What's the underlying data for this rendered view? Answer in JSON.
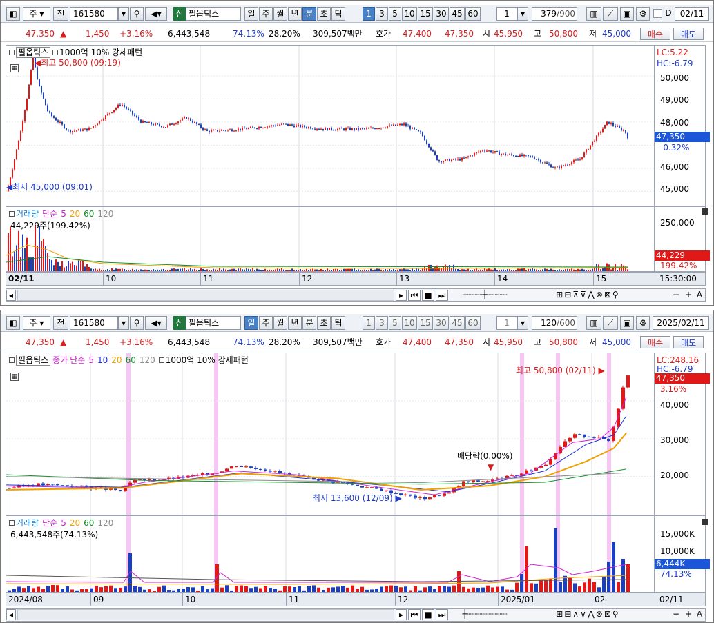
{
  "top": {
    "toolbar": {
      "type_label": "주",
      "prev_label": "전",
      "code": "161580",
      "market_badge": "신",
      "name": "필옵틱스",
      "periods": [
        "일",
        "주",
        "월",
        "년",
        "분",
        "초",
        "틱"
      ],
      "active_period": "분",
      "intervals": [
        "1",
        "3",
        "5",
        "10",
        "15",
        "30",
        "45",
        "60"
      ],
      "active_interval": "1",
      "unit_value": "1",
      "count": "379",
      "count_max": "/900",
      "d_label": "D",
      "date": "02/11"
    },
    "quote": {
      "price": "47,350",
      "arrow": "▲",
      "change": "1,450",
      "change_pct": "+3.16%",
      "volume": "6,443,548",
      "vol_ratio": "74.13%",
      "turnover": "28.20%",
      "amount": "309,507백만",
      "hoga_label": "호가",
      "ask": "47,400",
      "bid": "47,350",
      "open_label": "시",
      "open": "45,950",
      "high_label": "고",
      "high": "50,800",
      "low_label": "저",
      "low": "45,000",
      "buy_label": "매수",
      "sell_label": "매도"
    },
    "legend": {
      "name": "필옵틱스",
      "pattern": "1000억 10% 강세패턴"
    },
    "price_axis": {
      "lc": "LC:5.22",
      "hc": "HC:-6.79",
      "ticks": [
        "50,000",
        "49,000",
        "48,000",
        "46,000",
        "45,000"
      ],
      "cur": "47,350",
      "cur_pct": "-0.32%"
    },
    "annotations": {
      "high": "최고 50,800 (09:19)",
      "low": "최저 45,000 (09:01)"
    },
    "volume": {
      "legend": {
        "title": "거래량",
        "ma_label": "단순",
        "ma5": "5",
        "ma20": "20",
        "ma60": "60",
        "ma120": "120"
      },
      "summary": "44,229주(199.42%)",
      "axis_tick": "250,000",
      "cur": "44,229",
      "cur_pct": "199.42%"
    },
    "xaxis": {
      "labels": [
        "02/11",
        "10",
        "11",
        "12",
        "13",
        "14",
        "15"
      ],
      "time": "15:30:00"
    }
  },
  "bottom": {
    "toolbar": {
      "type_label": "주",
      "prev_label": "전",
      "code": "161580",
      "market_badge": "신",
      "name": "필옵틱스",
      "periods": [
        "일",
        "주",
        "월",
        "년",
        "분",
        "초",
        "틱"
      ],
      "active_period": "일",
      "intervals": [
        "1",
        "3",
        "5",
        "10",
        "15",
        "30",
        "45",
        "60"
      ],
      "unit_value": "1",
      "count": "120",
      "count_max": "/600",
      "date": "2025/02/11"
    },
    "quote": {
      "price": "47,350",
      "arrow": "▲",
      "change": "1,450",
      "change_pct": "+3.16%",
      "volume": "6,443,548",
      "vol_ratio": "74.13%",
      "turnover": "28.20%",
      "amount": "309,507백만",
      "hoga_label": "호가",
      "ask": "47,400",
      "bid": "47,350",
      "open_label": "시",
      "open": "45,950",
      "high_label": "고",
      "high": "50,800",
      "low_label": "저",
      "low": "45,000",
      "buy_label": "매수",
      "sell_label": "매도"
    },
    "legend": {
      "name": "필옵틱스",
      "close_label": "종가",
      "ma_label": "단순",
      "ma5": "5",
      "ma10": "10",
      "ma20": "20",
      "ma60": "60",
      "ma120": "120",
      "pattern": "1000억 10% 강세패턴"
    },
    "price_axis": {
      "lc": "LC:248.16",
      "hc": "HC:-6.79",
      "ticks": [
        "40,000",
        "30,000",
        "20,000"
      ],
      "cur": "47,350",
      "cur_pct": "3.16%"
    },
    "annotations": {
      "high": "최고 50,800 (02/11)",
      "low": "최저 13,600 (12/09)",
      "dividend": "배당락(0.00%)"
    },
    "volume": {
      "legend": {
        "title": "거래량",
        "ma_label": "단순",
        "ma5": "5",
        "ma20": "20",
        "ma60": "60",
        "ma120": "120"
      },
      "summary": "6,443,548주(74.13%)",
      "axis_ticks": [
        "15,000K",
        "10,000K"
      ],
      "cur": "6,444K",
      "cur_pct": "74.13%"
    },
    "xaxis": {
      "labels": [
        "2024/08",
        "09",
        "10",
        "11",
        "12",
        "2025/01",
        "02"
      ],
      "end": "02/11"
    }
  },
  "colors": {
    "up": "#e01818",
    "down": "#1b3fbf",
    "ma5": "#d020d0",
    "ma10": "#1c2fd0",
    "ma20": "#f0a000",
    "ma60": "#12902a",
    "ma120": "#8a8a8a",
    "highlight": "#f7c6f5"
  }
}
